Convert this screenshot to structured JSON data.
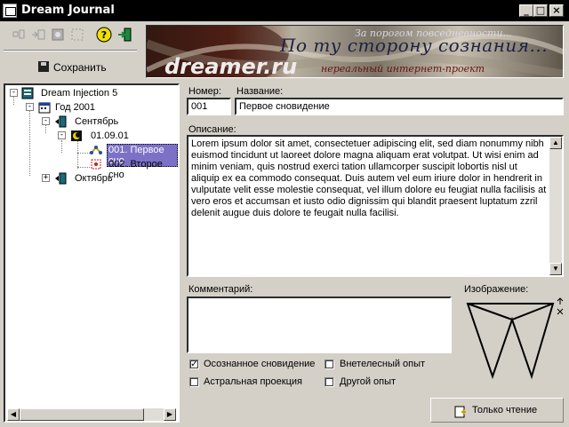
{
  "window": {
    "title": "Dream Journal",
    "controls": [
      "_",
      "□",
      "×"
    ]
  },
  "toolbar": {
    "save_label": "Сохранить",
    "help_glyph": "?"
  },
  "banner": {
    "line1": "За порогом повседневности...",
    "line2": "По ту сторону сознания...",
    "site": "dreamer.ru",
    "tagline": "нереальный интернет-проект"
  },
  "tree": {
    "root": "Dream Injection 5",
    "year": "Год 2001",
    "month1": "Сентябрь",
    "date": "01.09.01",
    "entry1": "001. Первое сно",
    "entry2": "002. Второе сно",
    "month2": "Октябрь"
  },
  "form": {
    "number_label": "Номер:",
    "number_value": "001",
    "name_label": "Название:",
    "name_value": "Первое сновидение",
    "description_label": "Описание:",
    "description_text": "Lorem ipsum dolor sit amet, consectetuer adipiscing elit, sed diam nonummy nibh euismod tincidunt ut laoreet dolore magna aliquam erat volutpat. Ut wisi enim ad minim veniam, quis nostrud exerci tation ullamcorper suscipit lobortis nisl ut aliquip ex ea commodo consequat. Duis autem vel eum iriure dolor in hendrerit in vulputate velit esse molestie consequat, vel illum dolore eu feugiat nulla facilisis at vero eros et accumsan et iusto odio dignissim qui blandit praesent luptatum zzril delenit augue duis dolore te feugait nulla facilisi.",
    "comment_label": "Комментарий:",
    "comment_value": "",
    "image_label": "Изображение:",
    "checkboxes": [
      {
        "label": "Осознанное сновидение",
        "checked": true
      },
      {
        "label": "Внетелесный опыт",
        "checked": false
      },
      {
        "label": "Астральная проекция",
        "checked": false
      },
      {
        "label": "Другой опыт",
        "checked": false
      }
    ],
    "readonly_label": "Только чтение"
  }
}
